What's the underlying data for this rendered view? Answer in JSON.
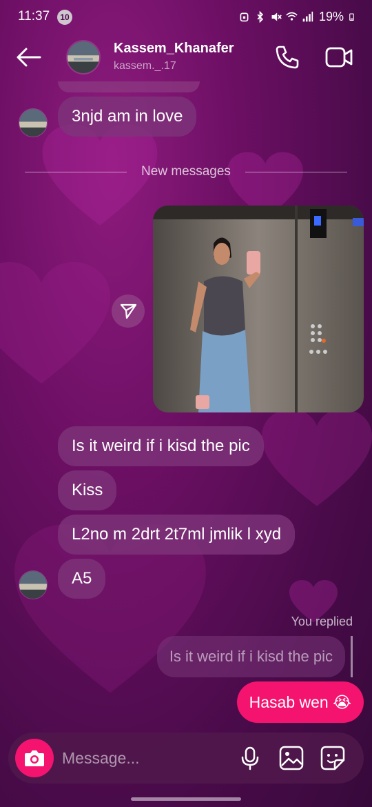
{
  "status_bar": {
    "time": "11:37",
    "notification_count": "10",
    "battery": "19%",
    "icons": [
      "alarm-icon",
      "bluetooth-icon",
      "mute-icon",
      "wifi-icon",
      "signal-icon",
      "battery-icon"
    ]
  },
  "header": {
    "username": "Kassem_Khanafer",
    "handle": "kassem._.17",
    "icons": [
      "back-arrow-icon",
      "phone-icon",
      "video-camera-icon"
    ]
  },
  "messages": {
    "received_1": "3njd am in love",
    "divider_label": "New messages",
    "received_2": "Is it weird if i kisd the pic",
    "received_3": "Kiss",
    "received_4": "L2no m 2drt 2t7ml jmlik l xyd",
    "received_5": "A5"
  },
  "reply": {
    "label": "You replied",
    "quoted": "Is it weird if i kisd the pic",
    "sent": "Hasab wen 😭"
  },
  "composer": {
    "placeholder": "Message..."
  },
  "colors": {
    "accent": "#f4136f",
    "background": "#6b0f63",
    "bubble": "#7e347a"
  }
}
